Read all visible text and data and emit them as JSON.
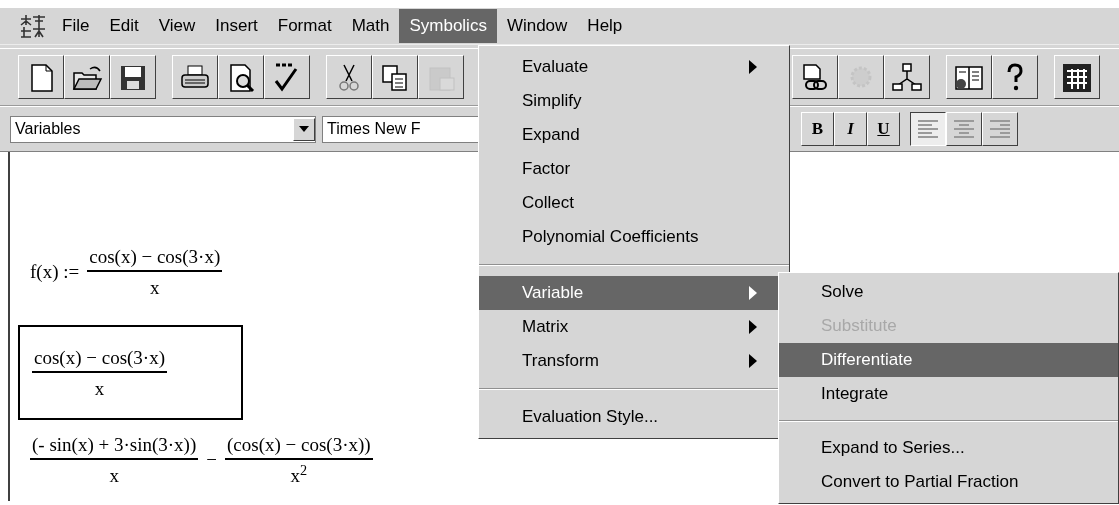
{
  "menubar": {
    "items": [
      {
        "label": "File",
        "selected": false
      },
      {
        "label": "Edit",
        "selected": false
      },
      {
        "label": "View",
        "selected": false
      },
      {
        "label": "Insert",
        "selected": false
      },
      {
        "label": "Format",
        "selected": false
      },
      {
        "label": "Math",
        "selected": false
      },
      {
        "label": "Symbolics",
        "selected": true
      },
      {
        "label": "Window",
        "selected": false
      },
      {
        "label": "Help",
        "selected": false
      }
    ]
  },
  "toolbar": {
    "groups": [
      [
        {
          "kind": "new",
          "disabled": false
        },
        {
          "kind": "open",
          "disabled": false
        },
        {
          "kind": "save",
          "disabled": false
        }
      ],
      [
        {
          "kind": "print",
          "disabled": false
        },
        {
          "kind": "preview",
          "disabled": false
        },
        {
          "kind": "spell",
          "disabled": false
        }
      ],
      [
        {
          "kind": "cut",
          "disabled": false
        },
        {
          "kind": "copy",
          "disabled": false
        },
        {
          "kind": "paste",
          "disabled": true
        }
      ],
      [
        {
          "kind": "link",
          "disabled": false
        },
        {
          "kind": "gear",
          "disabled": true
        },
        {
          "kind": "tree",
          "disabled": false
        }
      ],
      [
        {
          "kind": "book",
          "disabled": false
        },
        {
          "kind": "help",
          "disabled": false
        }
      ],
      [
        {
          "kind": "calculator",
          "disabled": false
        }
      ]
    ]
  },
  "format_bar": {
    "style": "Variables",
    "font": "Times New F",
    "buttons": [
      {
        "label": "B"
      },
      {
        "label": "I"
      },
      {
        "label": "U"
      }
    ],
    "align": [
      {
        "kind": "left",
        "selected": true
      },
      {
        "kind": "center",
        "selected": false
      },
      {
        "kind": "right",
        "selected": false
      }
    ]
  },
  "worksheet": {
    "definition": {
      "lhs": "f(x) :=",
      "numerator": "cos(x) − cos(3·x)",
      "denominator": "x"
    },
    "selected_expression": {
      "numerator": "cos(x) − cos(3·x)",
      "denominator": "x"
    },
    "result": {
      "terms": [
        {
          "numerator": "(- sin(x) + 3·sin(3·x))",
          "denominator": "x"
        },
        {
          "numerator": "(cos(x) − cos(3·x))",
          "denominator": "x$^{2}$"
        }
      ],
      "operator": "−"
    }
  },
  "symbolics_menu": {
    "items": [
      {
        "kind": "item",
        "label": "Evaluate",
        "submenu": true,
        "selected": false
      },
      {
        "kind": "item",
        "label": "Simplify",
        "submenu": false,
        "selected": false
      },
      {
        "kind": "item",
        "label": "Expand",
        "submenu": false,
        "selected": false
      },
      {
        "kind": "item",
        "label": "Factor",
        "submenu": false,
        "selected": false
      },
      {
        "kind": "item",
        "label": "Collect",
        "submenu": false,
        "selected": false
      },
      {
        "kind": "item",
        "label": "Polynomial Coefficients",
        "submenu": false,
        "selected": false
      },
      {
        "kind": "separator"
      },
      {
        "kind": "item",
        "label": "Variable",
        "submenu": true,
        "selected": true
      },
      {
        "kind": "item",
        "label": "Matrix",
        "submenu": true,
        "selected": false
      },
      {
        "kind": "item",
        "label": "Transform",
        "submenu": true,
        "selected": false
      },
      {
        "kind": "separator"
      },
      {
        "kind": "item",
        "label": "Evaluation Style...",
        "submenu": false,
        "selected": false
      }
    ]
  },
  "variable_submenu": {
    "items": [
      {
        "kind": "item",
        "label": "Solve",
        "disabled": false,
        "selected": false
      },
      {
        "kind": "item",
        "label": "Substitute",
        "disabled": true,
        "selected": false
      },
      {
        "kind": "item",
        "label": "Differentiate",
        "disabled": false,
        "selected": true
      },
      {
        "kind": "item",
        "label": "Integrate",
        "disabled": false,
        "selected": false
      },
      {
        "kind": "separator"
      },
      {
        "kind": "item",
        "label": "Expand to Series...",
        "disabled": false,
        "selected": false
      },
      {
        "kind": "item",
        "label": "Convert to Partial Fraction",
        "disabled": false,
        "selected": false
      }
    ]
  }
}
